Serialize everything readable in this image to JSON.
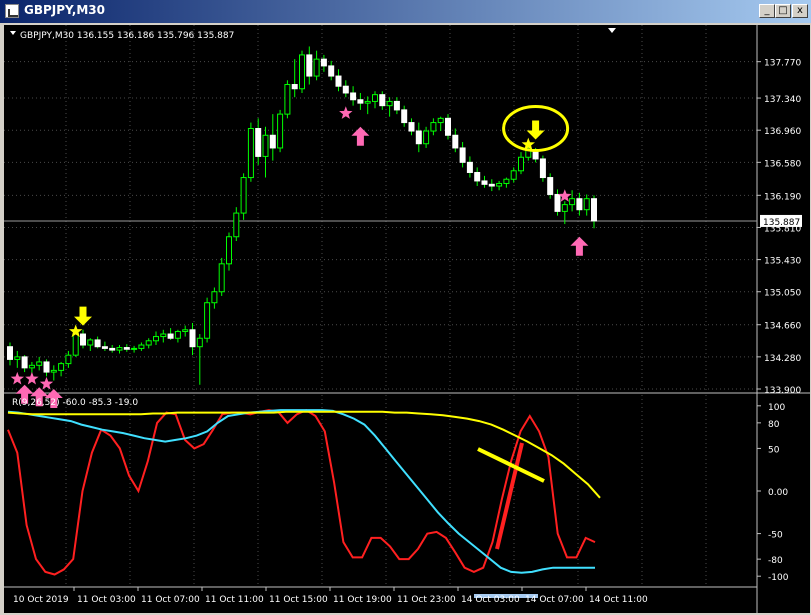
{
  "window": {
    "title": "GBPJPY,M30",
    "buttons": {
      "minimize": "_",
      "maximize": "□",
      "close": "x"
    }
  },
  "chart_data": {
    "type": "candlestick",
    "info_line": "GBPJPY,M30  136.155 136.186 135.796 135.887",
    "price_axis": {
      "ticks": [
        "137.770",
        "137.340",
        "136.960",
        "136.580",
        "136.190",
        "135.810",
        "135.430",
        "135.050",
        "134.660",
        "134.280",
        "133.900"
      ],
      "ylim": [
        133.9,
        138.05
      ],
      "current_price": "135.887",
      "current_value": 135.887
    },
    "candles": [
      [
        134.4,
        134.45,
        134.18,
        134.25
      ],
      [
        134.25,
        134.35,
        134.15,
        134.28
      ],
      [
        134.28,
        134.3,
        134.1,
        134.15
      ],
      [
        134.15,
        134.22,
        134.05,
        134.18
      ],
      [
        134.18,
        134.28,
        134.12,
        134.22
      ],
      [
        134.22,
        134.25,
        134.05,
        134.1
      ],
      [
        134.1,
        134.18,
        134.0,
        134.12
      ],
      [
        134.12,
        134.22,
        134.05,
        134.2
      ],
      [
        134.2,
        134.35,
        134.15,
        134.3
      ],
      [
        134.3,
        134.62,
        134.28,
        134.55
      ],
      [
        134.55,
        134.6,
        134.38,
        134.42
      ],
      [
        134.42,
        134.5,
        134.35,
        134.48
      ],
      [
        134.48,
        134.52,
        134.38,
        134.4
      ],
      [
        134.4,
        134.46,
        134.35,
        134.38
      ],
      [
        134.38,
        134.42,
        134.33,
        134.36
      ],
      [
        134.36,
        134.42,
        134.32,
        134.39
      ],
      [
        134.39,
        134.43,
        134.34,
        134.37
      ],
      [
        134.37,
        134.41,
        134.33,
        134.38
      ],
      [
        134.38,
        134.45,
        134.35,
        134.42
      ],
      [
        134.42,
        134.5,
        134.38,
        134.47
      ],
      [
        134.47,
        134.58,
        134.42,
        134.52
      ],
      [
        134.52,
        134.6,
        134.45,
        134.55
      ],
      [
        134.55,
        134.62,
        134.48,
        134.5
      ],
      [
        134.5,
        134.6,
        134.45,
        134.58
      ],
      [
        134.58,
        134.65,
        134.52,
        134.6
      ],
      [
        134.6,
        134.68,
        134.3,
        134.4
      ],
      [
        134.4,
        134.55,
        133.95,
        134.5
      ],
      [
        134.5,
        134.98,
        134.45,
        134.92
      ],
      [
        134.92,
        135.1,
        134.85,
        135.05
      ],
      [
        135.05,
        135.45,
        135.0,
        135.38
      ],
      [
        135.38,
        135.75,
        135.3,
        135.7
      ],
      [
        135.7,
        136.05,
        135.65,
        135.98
      ],
      [
        135.98,
        136.45,
        135.9,
        136.4
      ],
      [
        136.4,
        137.05,
        136.35,
        136.98
      ],
      [
        136.98,
        137.1,
        136.55,
        136.65
      ],
      [
        136.65,
        137.0,
        136.4,
        136.9
      ],
      [
        136.9,
        137.15,
        136.6,
        136.75
      ],
      [
        136.75,
        137.2,
        136.7,
        137.15
      ],
      [
        137.15,
        137.55,
        137.1,
        137.5
      ],
      [
        137.5,
        137.8,
        137.35,
        137.45
      ],
      [
        137.45,
        137.9,
        137.4,
        137.85
      ],
      [
        137.85,
        137.95,
        137.5,
        137.6
      ],
      [
        137.6,
        137.9,
        137.55,
        137.8
      ],
      [
        137.8,
        137.85,
        137.65,
        137.72
      ],
      [
        137.72,
        137.78,
        137.55,
        137.6
      ],
      [
        137.6,
        137.68,
        137.42,
        137.48
      ],
      [
        137.48,
        137.55,
        137.35,
        137.4
      ],
      [
        137.4,
        137.48,
        137.25,
        137.32
      ],
      [
        137.32,
        137.4,
        137.2,
        137.28
      ],
      [
        137.28,
        137.36,
        137.15,
        137.3
      ],
      [
        137.3,
        137.42,
        137.22,
        137.38
      ],
      [
        137.38,
        137.42,
        137.2,
        137.25
      ],
      [
        137.25,
        137.35,
        137.12,
        137.3
      ],
      [
        137.3,
        137.35,
        137.15,
        137.2
      ],
      [
        137.2,
        137.25,
        137.0,
        137.05
      ],
      [
        137.05,
        137.1,
        136.9,
        136.95
      ],
      [
        136.95,
        137.05,
        136.7,
        136.8
      ],
      [
        136.8,
        137.0,
        136.75,
        136.95
      ],
      [
        136.95,
        137.1,
        136.9,
        137.05
      ],
      [
        137.05,
        137.12,
        136.95,
        137.1
      ],
      [
        137.1,
        137.15,
        136.85,
        136.9
      ],
      [
        136.9,
        136.98,
        136.7,
        136.75
      ],
      [
        136.75,
        136.82,
        136.52,
        136.58
      ],
      [
        136.58,
        136.65,
        136.4,
        136.46
      ],
      [
        136.46,
        136.52,
        136.3,
        136.36
      ],
      [
        136.36,
        136.42,
        136.28,
        136.32
      ],
      [
        136.32,
        136.38,
        136.24,
        136.3
      ],
      [
        136.3,
        136.36,
        136.25,
        136.33
      ],
      [
        136.33,
        136.4,
        136.28,
        136.38
      ],
      [
        136.38,
        136.52,
        136.34,
        136.48
      ],
      [
        136.48,
        136.7,
        136.44,
        136.64
      ],
      [
        136.64,
        136.78,
        136.6,
        136.72
      ],
      [
        136.72,
        136.75,
        136.58,
        136.62
      ],
      [
        136.62,
        136.66,
        136.35,
        136.4
      ],
      [
        136.4,
        136.45,
        136.15,
        136.2
      ],
      [
        136.2,
        136.26,
        135.95,
        136.0
      ],
      [
        136.0,
        136.12,
        135.85,
        136.08
      ],
      [
        136.08,
        136.25,
        136.0,
        136.15
      ],
      [
        136.15,
        136.22,
        135.95,
        136.02
      ],
      [
        136.02,
        136.2,
        135.95,
        136.15
      ],
      [
        136.15,
        136.19,
        135.8,
        135.887
      ]
    ],
    "star_markers": [
      {
        "index": 1,
        "price": 134.02,
        "color": "#ff69b4"
      },
      {
        "index": 3,
        "price": 134.02,
        "color": "#ff69b4"
      },
      {
        "index": 5,
        "price": 133.96,
        "color": "#ff69b4"
      },
      {
        "index": 9,
        "price": 134.58,
        "color": "#ffff00"
      },
      {
        "index": 46,
        "price": 137.16,
        "color": "#ff69b4"
      },
      {
        "index": 71,
        "price": 136.79,
        "color": "#ffff00"
      },
      {
        "index": 76,
        "price": 136.18,
        "color": "#ff69b4"
      }
    ],
    "arrow_markers": [
      {
        "index": 2,
        "price": 133.95,
        "dir": "up",
        "color": "#ff69b4"
      },
      {
        "index": 4,
        "price": 133.92,
        "dir": "up",
        "color": "#ff69b4"
      },
      {
        "index": 6,
        "price": 133.9,
        "dir": "up",
        "color": "#ff69b4"
      },
      {
        "index": 10,
        "price": 134.65,
        "dir": "down",
        "color": "#ffff00"
      },
      {
        "index": 48,
        "price": 137.0,
        "dir": "up",
        "color": "#ff69b4"
      },
      {
        "index": 72,
        "price": 136.85,
        "dir": "down",
        "color": "#ffff00"
      },
      {
        "index": 78,
        "price": 135.7,
        "dir": "up",
        "color": "#ff69b4"
      }
    ],
    "circle_marker": {
      "index": 72,
      "price": 136.98,
      "color": "#ffff00"
    },
    "oscillator": {
      "label": "R(9,26,52) -60.0 -85.3 -19.0",
      "ticks": [
        "100",
        "80",
        "50",
        "0.00",
        "-50",
        "-80",
        "-100"
      ],
      "tick_values": [
        100,
        80,
        50,
        0,
        -50,
        -80,
        -100
      ],
      "ylim": [
        -108,
        108
      ],
      "series": [
        {
          "color": "#ff2020",
          "values": [
            72,
            45,
            -40,
            -80,
            -95,
            -98,
            -92,
            -80,
            0,
            45,
            72,
            65,
            50,
            18,
            0,
            35,
            80,
            92,
            90,
            60,
            50,
            55,
            72,
            90,
            92,
            92,
            90,
            93,
            95,
            93,
            80,
            90,
            95,
            88,
            70,
            10,
            -60,
            -78,
            -78,
            -55,
            -55,
            -65,
            -80,
            -80,
            -68,
            -50,
            -48,
            -55,
            -72,
            -90,
            -95,
            -90,
            -60,
            -10,
            35,
            70,
            88,
            70,
            40,
            -50,
            -78,
            -78,
            -55,
            -60
          ]
        },
        {
          "color": "#40e0ff",
          "values": [
            93,
            92,
            90,
            88,
            86,
            84,
            82,
            78,
            75,
            72,
            70,
            68,
            65,
            62,
            60,
            58,
            60,
            62,
            65,
            70,
            80,
            88,
            90,
            92,
            93,
            94,
            95,
            95,
            95,
            95,
            95,
            94,
            90,
            85,
            78,
            65,
            50,
            35,
            20,
            5,
            -10,
            -25,
            -38,
            -50,
            -60,
            -70,
            -80,
            -90,
            -95,
            -96,
            -95,
            -92,
            -90,
            -90,
            -90,
            -90,
            -90
          ]
        },
        {
          "color": "#ffff00",
          "values": [
            92,
            91,
            90,
            90,
            90,
            90,
            90,
            90,
            90,
            90,
            90,
            90,
            91,
            91,
            92,
            92,
            92,
            92,
            92,
            92,
            92,
            92,
            92,
            93,
            93,
            93,
            93,
            93,
            93,
            93,
            93,
            93,
            92,
            92,
            91,
            90,
            89,
            87,
            85,
            82,
            78,
            72,
            65,
            58,
            50,
            42,
            32,
            20,
            8,
            -8
          ]
        }
      ],
      "series_x_end": [
        591,
        591,
        596
      ]
    },
    "time_axis": {
      "labels": [
        "10 Oct 2019",
        "11 Oct 03:00",
        "11 Oct 07:00",
        "11 Oct 11:00",
        "11 Oct 15:00",
        "11 Oct 19:00",
        "11 Oct 23:00",
        "14 Oct 03:00",
        "14 Oct 07:00",
        "14 Oct 11:00"
      ]
    }
  }
}
